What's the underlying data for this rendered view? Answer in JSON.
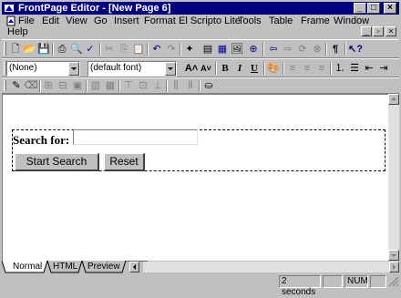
{
  "window": {
    "title": "FrontPage Editor - [New Page 6]",
    "minimize": "_",
    "maximize": "□",
    "close": "×"
  },
  "menu": {
    "items": [
      "File",
      "Edit",
      "View",
      "Go",
      "Insert",
      "Format",
      "El Scripto Lite",
      "Tools",
      "Table",
      "Frame",
      "Window",
      "Help"
    ]
  },
  "format_toolbar": {
    "style_value": "(None)",
    "font_value": "(default font)"
  },
  "page": {
    "form_label": "Search for:",
    "search_value": "",
    "start_button": "Start Search",
    "reset_button": "Reset"
  },
  "tabs": [
    "Normal",
    "HTML",
    "Preview"
  ],
  "status": {
    "time": "2 seconds",
    "num": "NUM"
  },
  "colors": {
    "titlebar": "#000080",
    "face": "#c0c0c0"
  }
}
